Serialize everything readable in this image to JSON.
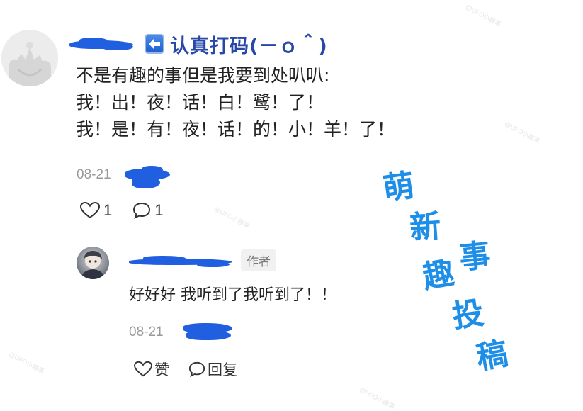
{
  "watermark": "@UFO小趣事",
  "main_comment": {
    "nickname": "认真打码(－ｏ＾)",
    "lines": [
      "不是有趣的事但是我要到处叭叭:",
      "我！出！夜！话！白！鹭！了！",
      "我！是！有！夜！话！的！小！羊！了！"
    ],
    "date": "08-21",
    "like_count": "1",
    "comment_count": "1"
  },
  "reply": {
    "badge": "作者",
    "text": "好好好 我听到了我听到了！！",
    "date": "08-21",
    "like_label": "赞",
    "reply_label": "回复"
  },
  "stamp_chars": [
    "萌",
    "新",
    "趣",
    "事",
    "投",
    "稿"
  ],
  "colors": {
    "stamp": "#1e8fe8",
    "redaction": "#1f5fe0",
    "nickname": "#2848a8",
    "meta": "#999999"
  },
  "icons": [
    "back-arrow-icon",
    "heart-icon",
    "comment-bubble-icon"
  ]
}
